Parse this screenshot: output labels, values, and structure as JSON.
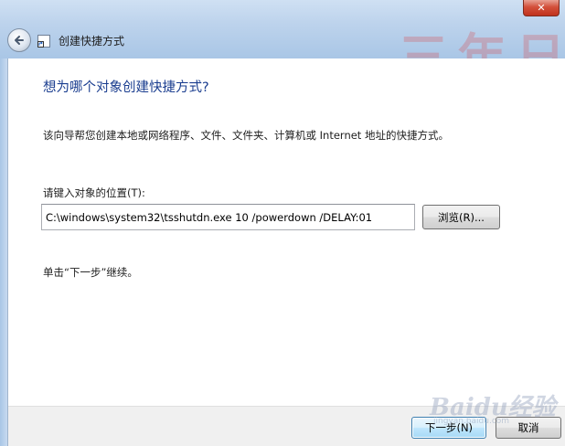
{
  "window": {
    "title": "创建快捷方式",
    "background_text": "三年日",
    "close_label": "✕"
  },
  "wizard": {
    "heading": "想为哪个对象创建快捷方式?",
    "description": "该向导帮您创建本地或网络程序、文件、文件夹、计算机或 Internet 地址的快捷方式。",
    "location_label": "请键入对象的位置(T):",
    "location_value": "C:\\windows\\system32\\tsshutdn.exe 10 /powerdown /DELAY:01",
    "browse_label": "浏览(R)...",
    "hint": "单击“下一步”继续。"
  },
  "footer": {
    "next_label": "下一步(N)",
    "cancel_label": "取消"
  },
  "watermark": {
    "text": "Baidu经验",
    "sub": "jingyan.baidu.com"
  },
  "colors": {
    "heading": "#1a3d8f",
    "glass": "#bdd3ec",
    "close": "#c0321d"
  }
}
